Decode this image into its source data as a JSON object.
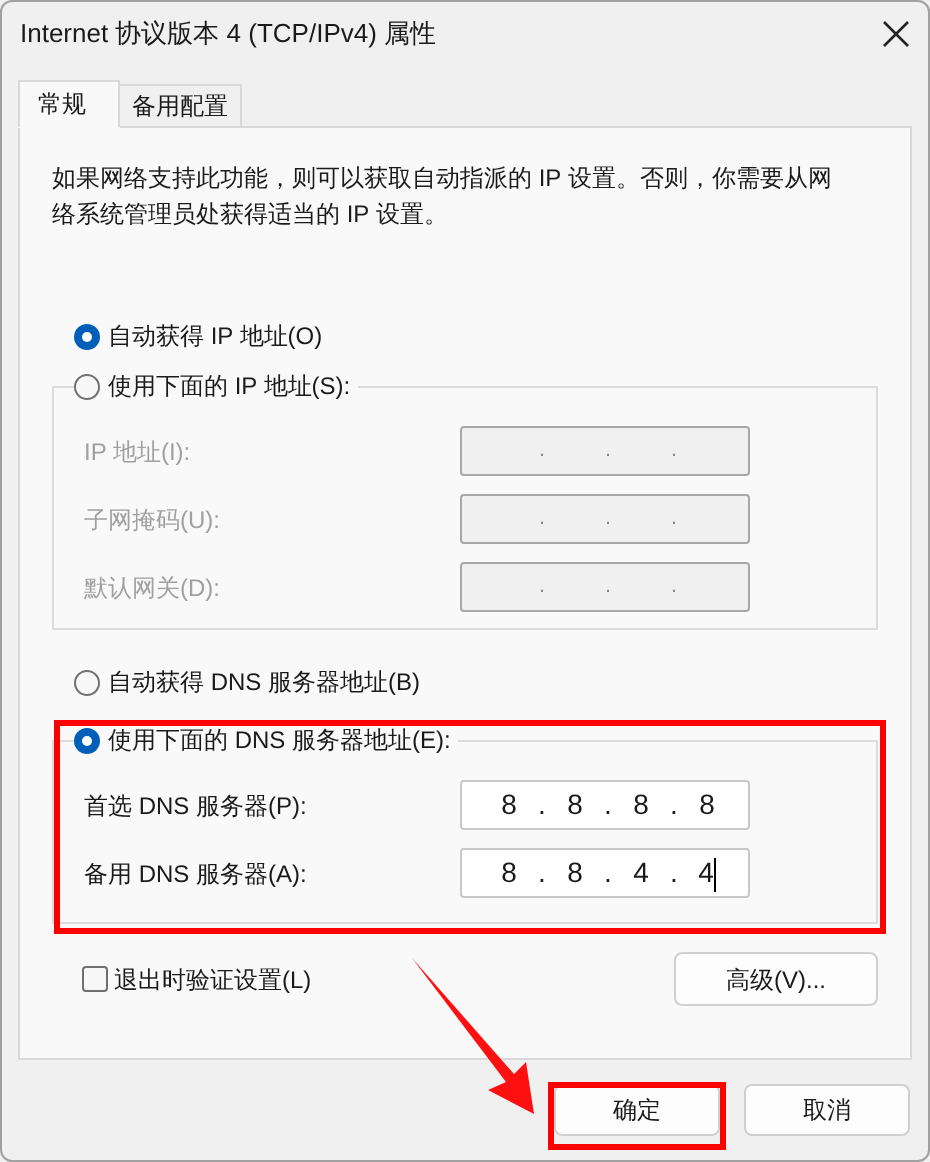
{
  "window": {
    "title": "Internet 协议版本 4 (TCP/IPv4) 属性"
  },
  "tabs": [
    {
      "label": "常规",
      "selected": true
    },
    {
      "label": "备用配置",
      "selected": false
    }
  ],
  "description": "如果网络支持此功能，则可以获取自动指派的 IP 设置。否则，你需要从网络系统管理员处获得适当的 IP 设置。",
  "ip_section": {
    "options": [
      {
        "label": "自动获得 IP 地址(O)",
        "selected": true
      },
      {
        "label": "使用下面的 IP 地址(S):",
        "selected": false
      }
    ],
    "fields": [
      {
        "label": "IP 地址(I):",
        "disabled": true,
        "separator": "."
      },
      {
        "label": "子网掩码(U):",
        "disabled": true,
        "separator": "."
      },
      {
        "label": "默认网关(D):",
        "disabled": true,
        "separator": "."
      }
    ]
  },
  "dns_section": {
    "options": [
      {
        "label": "自动获得 DNS 服务器地址(B)",
        "selected": false
      },
      {
        "label": "使用下面的 DNS 服务器地址(E):",
        "selected": true
      }
    ],
    "fields": [
      {
        "label": "首选 DNS 服务器(P):",
        "disabled": false,
        "separator": ".",
        "octets": [
          "8",
          "8",
          "8",
          "8"
        ],
        "focused": false
      },
      {
        "label": "备用 DNS 服务器(A):",
        "disabled": false,
        "separator": ".",
        "octets": [
          "8",
          "8",
          "4",
          "4"
        ],
        "focused": true
      }
    ]
  },
  "verify_on_exit": {
    "label": "退出时验证设置(L)",
    "checked": false
  },
  "advanced_button": "高级(V)...",
  "buttons": [
    "确定",
    "取消"
  ]
}
